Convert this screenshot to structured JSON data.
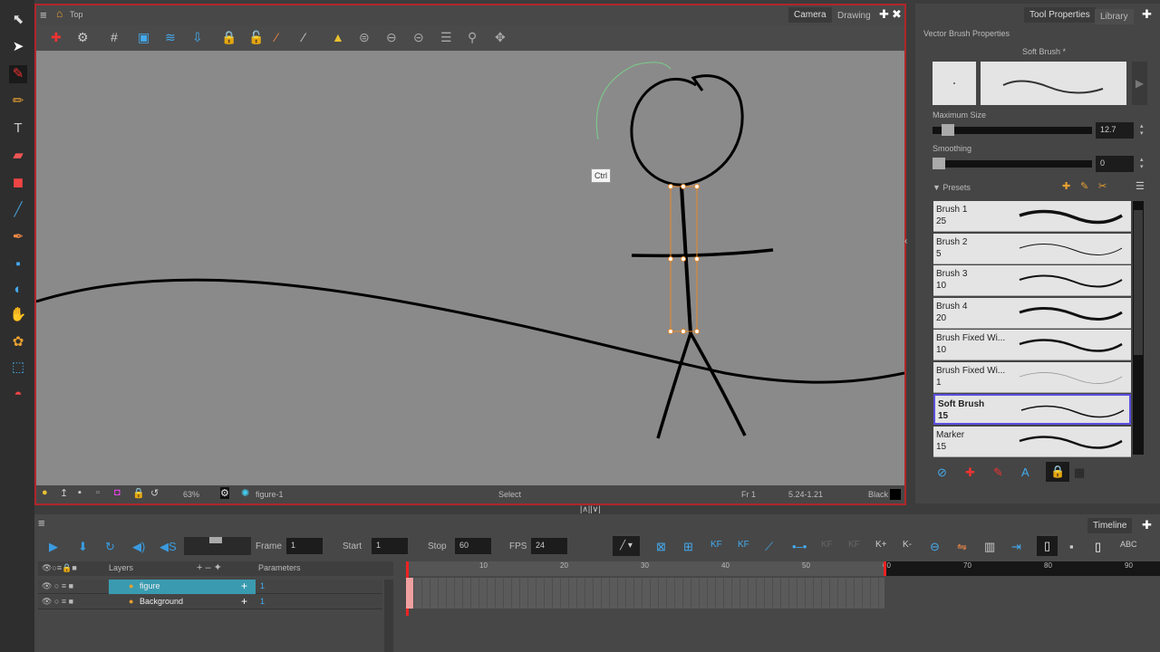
{
  "camera": {
    "breadcrumb": "Top",
    "tabs": [
      "Camera",
      "Drawing"
    ],
    "active_tab": "Camera"
  },
  "canvas": {
    "tooltip": "Ctrl"
  },
  "status": {
    "zoom": "63%",
    "drawing_name": "figure-1",
    "tool": "Select",
    "frame": "Fr 1",
    "coords": "5.24-1.21",
    "color_name": "Black"
  },
  "right_panel": {
    "tabs": [
      "Tool Properties",
      "Library"
    ],
    "section": "Vector Brush Properties",
    "brush_name": "Soft Brush *",
    "max_size_label": "Maximum Size",
    "max_size_value": "12.7",
    "max_size_fraction": 0.08,
    "smoothing_label": "Smoothing",
    "smoothing_value": "0",
    "smoothing_fraction": 0,
    "presets_label": "Presets",
    "presets": [
      {
        "name": "Brush 1",
        "size": "25"
      },
      {
        "name": "Brush 2",
        "size": "5"
      },
      {
        "name": "Brush 3",
        "size": "10"
      },
      {
        "name": "Brush 4",
        "size": "20"
      },
      {
        "name": "Brush Fixed Wi...",
        "size": "10"
      },
      {
        "name": "Brush Fixed Wi...",
        "size": "1"
      },
      {
        "name": "Soft Brush",
        "size": "15",
        "selected": true
      },
      {
        "name": "Marker",
        "size": "15"
      }
    ]
  },
  "timeline": {
    "tab": "Timeline",
    "frame_label": "Frame",
    "frame": "1",
    "start_label": "Start",
    "start": "1",
    "stop_label": "Stop",
    "stop": "60",
    "fps_label": "FPS",
    "fps": "24",
    "layers_header": "Layers",
    "params_header": "Parameters",
    "layers": [
      {
        "name": "figure",
        "param": "1",
        "selected": true
      },
      {
        "name": "Background",
        "param": "1"
      }
    ],
    "ruler": [
      "10",
      "20",
      "30",
      "40",
      "50",
      "60",
      "70",
      "80",
      "90"
    ],
    "keyframe_buttons": [
      "KF",
      "KF",
      "KF",
      "KF",
      "K+",
      "K-"
    ]
  },
  "colors": {
    "accent_red": "#b0262b",
    "layer_selected": "#3a9bb0",
    "preset_selected": "#5a4fe0"
  }
}
